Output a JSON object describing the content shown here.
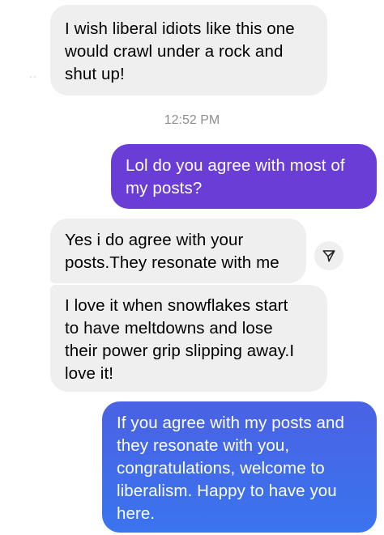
{
  "messages": [
    {
      "direction": "incoming",
      "lines": [
        "I wish liberal idiots like this one",
        "would crawl under a rock and",
        "shut up!"
      ]
    },
    {
      "direction": "outgoing",
      "lines": [
        "Lol do you agree with most of",
        "my posts?"
      ]
    },
    {
      "direction": "incoming",
      "lines": [
        "Yes i do agree with your",
        "posts.They resonate with me"
      ]
    },
    {
      "direction": "incoming",
      "lines": [
        "I love it when snowflakes start",
        "to have meltdowns and lose",
        "their power grip slipping away.I",
        "love it!"
      ]
    },
    {
      "direction": "outgoing",
      "lines": [
        "If you agree with my posts and",
        "they resonate with you,",
        "congratulations, welcome to",
        "liberalism. Happy to have you",
        "here."
      ]
    }
  ],
  "timestamp": "12:52 PM",
  "icons": {
    "share": "paper-plane-icon"
  },
  "colors": {
    "incoming_bubble": "#efefef",
    "outgoing_purple": "#6a3ed6",
    "outgoing_blue": "#3a74ee",
    "timestamp_text": "#8e8e8e"
  }
}
